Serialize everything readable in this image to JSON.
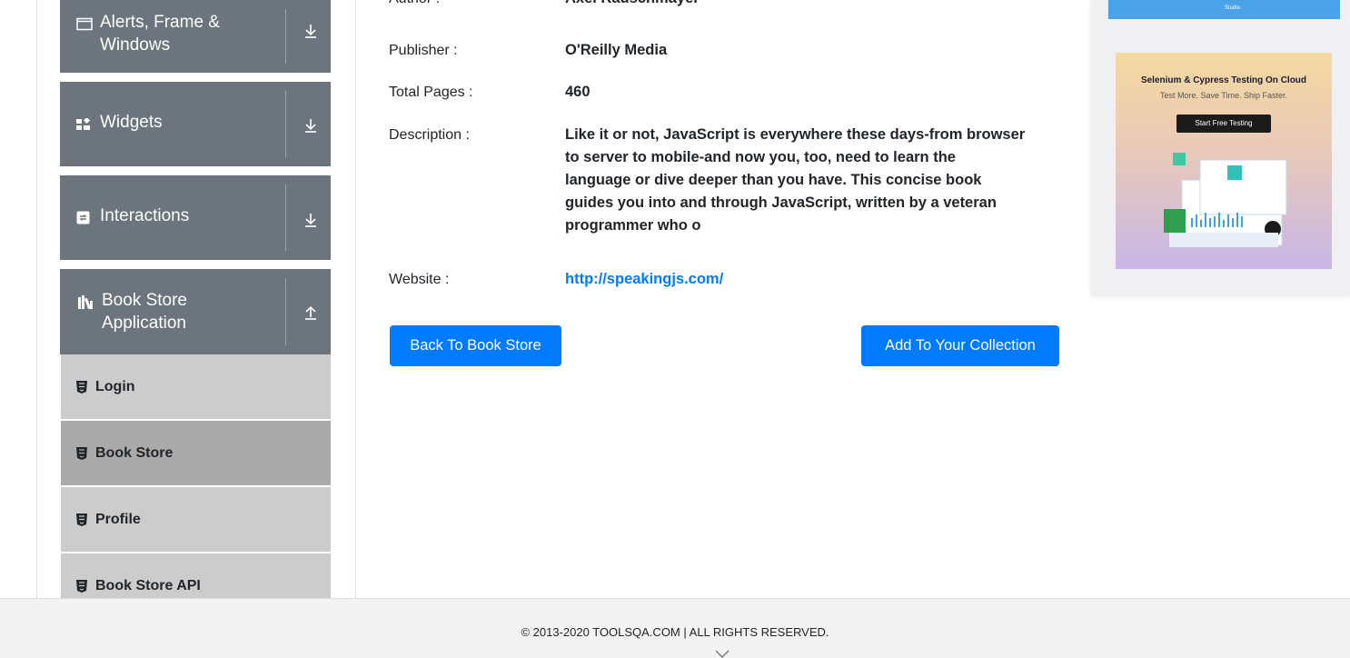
{
  "sidebar": {
    "groups": [
      {
        "label_lines": [
          "Alerts, Frame &",
          "Windows"
        ],
        "icon": "window-icon",
        "arrow": "download-arrow-icon"
      },
      {
        "label_lines": [
          "Widgets"
        ],
        "icon": "widgets-icon",
        "arrow": "download-arrow-icon"
      },
      {
        "label_lines": [
          "Interactions"
        ],
        "icon": "interactions-icon",
        "arrow": "download-arrow-icon"
      },
      {
        "label_lines": [
          "Book Store",
          "Application"
        ],
        "icon": "books-icon",
        "arrow": "upload-arrow-icon"
      }
    ],
    "items": [
      {
        "label": "Login",
        "active": false
      },
      {
        "label": "Book Store",
        "active": true
      },
      {
        "label": "Profile",
        "active": false
      },
      {
        "label": "Book Store API",
        "active": false
      }
    ]
  },
  "book": {
    "author_label": "Author :",
    "author": "Axel Rauschmayer",
    "publisher_label": "Publisher :",
    "publisher": "O'Reilly Media",
    "pages_label": "Total Pages :",
    "pages": "460",
    "description_label": "Description :",
    "description_lines": [
      "Like it or not, JavaScript is everywhere these days-from browser",
      "to server to mobile-and now you, too, need to learn the",
      "language or dive deeper than you have. This concise book",
      "guides you into and through JavaScript, written by a veteran",
      "programmer who o"
    ],
    "website_label": "Website :",
    "website": "http://speakingjs.com/"
  },
  "buttons": {
    "back": "Back To Book Store",
    "add": "Add To Your Collection"
  },
  "ad": {
    "top_text": "Studio",
    "title": "Selenium & Cypress Testing On Cloud",
    "subtitle": "Test More. Save Time. Ship Faster.",
    "cta": "Start Free Testing"
  },
  "footer": {
    "copyright": "© 2013-2020 TOOLSQA.COM | ALL RIGHTS RESERVED."
  },
  "colors": {
    "sidebar_header": "#6c757d",
    "menu_item": "#cccccc",
    "menu_active": "#aaaaaa",
    "primary": "#007bff"
  }
}
